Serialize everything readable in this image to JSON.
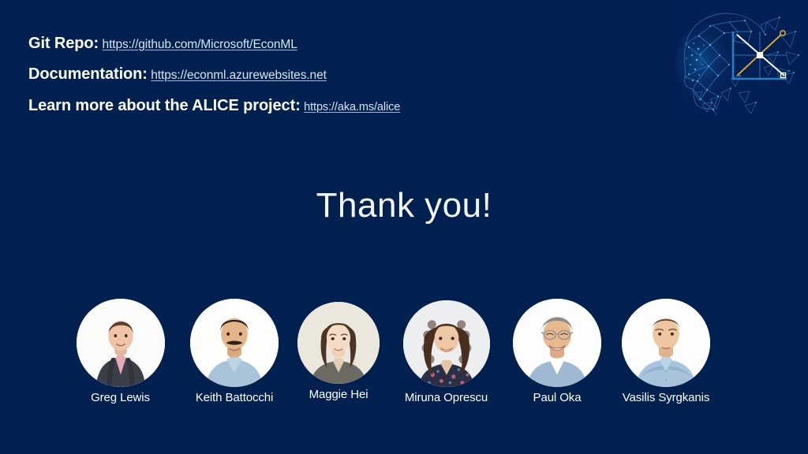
{
  "slide": {
    "background_color": "#00214f",
    "title": "Thank you!"
  },
  "links": [
    {
      "id": "git-repo",
      "label": "Git Repo:",
      "url": "https://github.com/Microsoft/EconML"
    },
    {
      "id": "documentation",
      "label": "Documentation:",
      "url": "https://econml.azurewebsites.net"
    },
    {
      "id": "alice-project",
      "label": "Learn more about the ALICE project:",
      "url": "https://aka.ms/alice"
    }
  ],
  "logo": {
    "name": "alice-project-logo",
    "description": "wireframe head profile with supply and demand chart",
    "colors": {
      "network": "#2a7fc9",
      "accent": "#3fd2f0",
      "axis": "#2e7cc4",
      "demand_line": "#ffffff",
      "supply_line": "#d9a441",
      "panel": "#032055"
    }
  },
  "team": {
    "members": [
      {
        "name": "Greg Lewis",
        "photo": "portrait-greg-lewis"
      },
      {
        "name": "Keith Battocchi",
        "photo": "portrait-keith-battocchi"
      },
      {
        "name": "Maggie Hei",
        "photo": "portrait-maggie-hei"
      },
      {
        "name": "Miruna Oprescu",
        "photo": "portrait-miruna-oprescu"
      },
      {
        "name": "Paul Oka",
        "photo": "portrait-paul-oka"
      },
      {
        "name": "Vasilis Syrgkanis",
        "photo": "portrait-vasilis-syrgkanis"
      }
    ]
  }
}
